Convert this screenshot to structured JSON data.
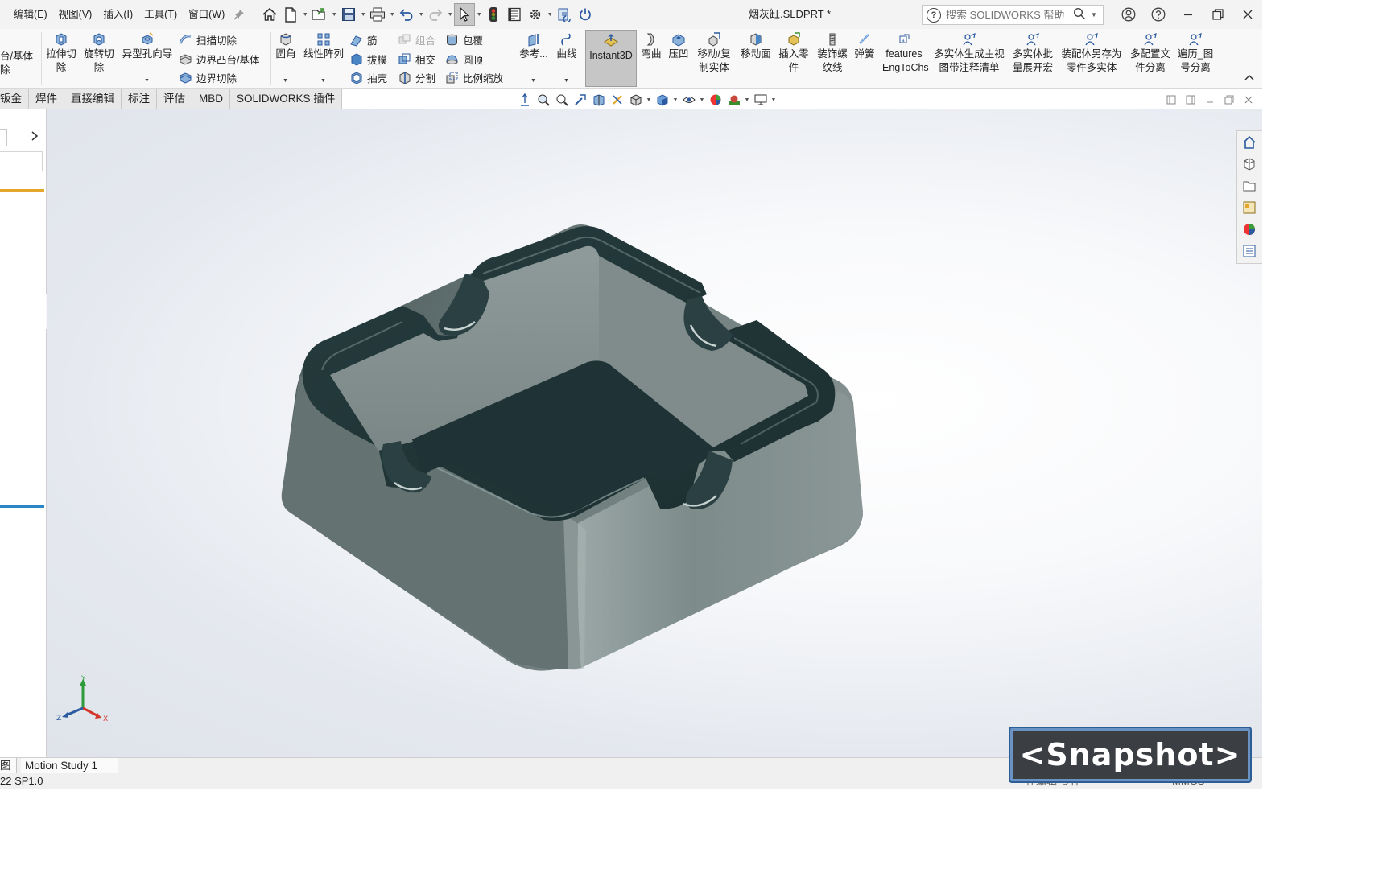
{
  "menu": {
    "items": [
      "编辑(E)",
      "视图(V)",
      "插入(I)",
      "工具(T)",
      "窗口(W)"
    ]
  },
  "window": {
    "title": "烟灰缸.SLDPRT *"
  },
  "search": {
    "placeholder": "搜索 SOLIDWORKS 帮助"
  },
  "commands": {
    "left_cut_1": "台/基体",
    "left_cut_2": "除",
    "extrude_cut": "拉伸切\n除",
    "extrude_cut_l1": "拉伸切",
    "extrude_cut_l2": "除",
    "revolve_cut_l1": "旋转切",
    "revolve_cut_l2": "除",
    "hole_wizard": "异型孔向导",
    "sweep_cut": "扫描切除",
    "boundary_boss": "边界凸台/基体",
    "boundary_cut": "边界切除",
    "fillet": "圆角",
    "linear_pattern": "线性阵列",
    "rib": "筋",
    "draft": "拔模",
    "shell": "抽壳",
    "combine": "组合",
    "intersect": "相交",
    "split": "分割",
    "wrap": "包覆",
    "dome": "圆顶",
    "scale": "比例缩放",
    "reference": "参考...",
    "curves": "曲线",
    "instant3d": "Instant3D",
    "flex": "弯曲",
    "indent": "压凹",
    "move_copy_l1": "移动/复",
    "move_copy_l2": "制实体",
    "move_face": "移动面",
    "insert_part_l1": "插入零",
    "insert_part_l2": "件",
    "cosmetic_thread_l1": "装饰螺",
    "cosmetic_thread_l2": "纹线",
    "spring": "弹簧",
    "features_l1": "features",
    "features_l2": "EngToChs",
    "multibody_l1": "多实体生成主视",
    "multibody_l2": "图带注释清单",
    "batch_l1": "多实体批",
    "batch_l2": "量展开宏",
    "asm_save_l1": "装配体另存为",
    "asm_save_l2": "零件多实体",
    "multi_config_l1": "多配置文",
    "multi_config_l2": "件分离",
    "traverse_l1": "遍历_图",
    "traverse_l2": "号分离"
  },
  "tabs": [
    "钣金",
    "焊件",
    "直接编辑",
    "标注",
    "评估",
    "MBD",
    "SOLIDWORKS 插件"
  ],
  "motion": {
    "left_tab": "图",
    "study_tab": "Motion Study 1"
  },
  "status": {
    "version": "22 SP1.0",
    "editing": "在编辑 零件",
    "units": "MMGS"
  },
  "snapshot": {
    "label": "<Snapshot>"
  },
  "triad": {
    "x": "X",
    "y": "Y",
    "z": "Z"
  },
  "colors": {
    "model_dark": "#1f3336",
    "model_side": "#6c7a79",
    "accent_orange": "#e4a72c",
    "accent_blue": "#2b86c6"
  },
  "icons": [
    "home-icon",
    "new-file-icon",
    "open-icon",
    "save-icon",
    "print-icon",
    "undo-icon",
    "redo-icon",
    "select-icon",
    "traffic-light-icon",
    "file-properties-icon",
    "options-icon",
    "rebuild-icon",
    "power-icon"
  ]
}
